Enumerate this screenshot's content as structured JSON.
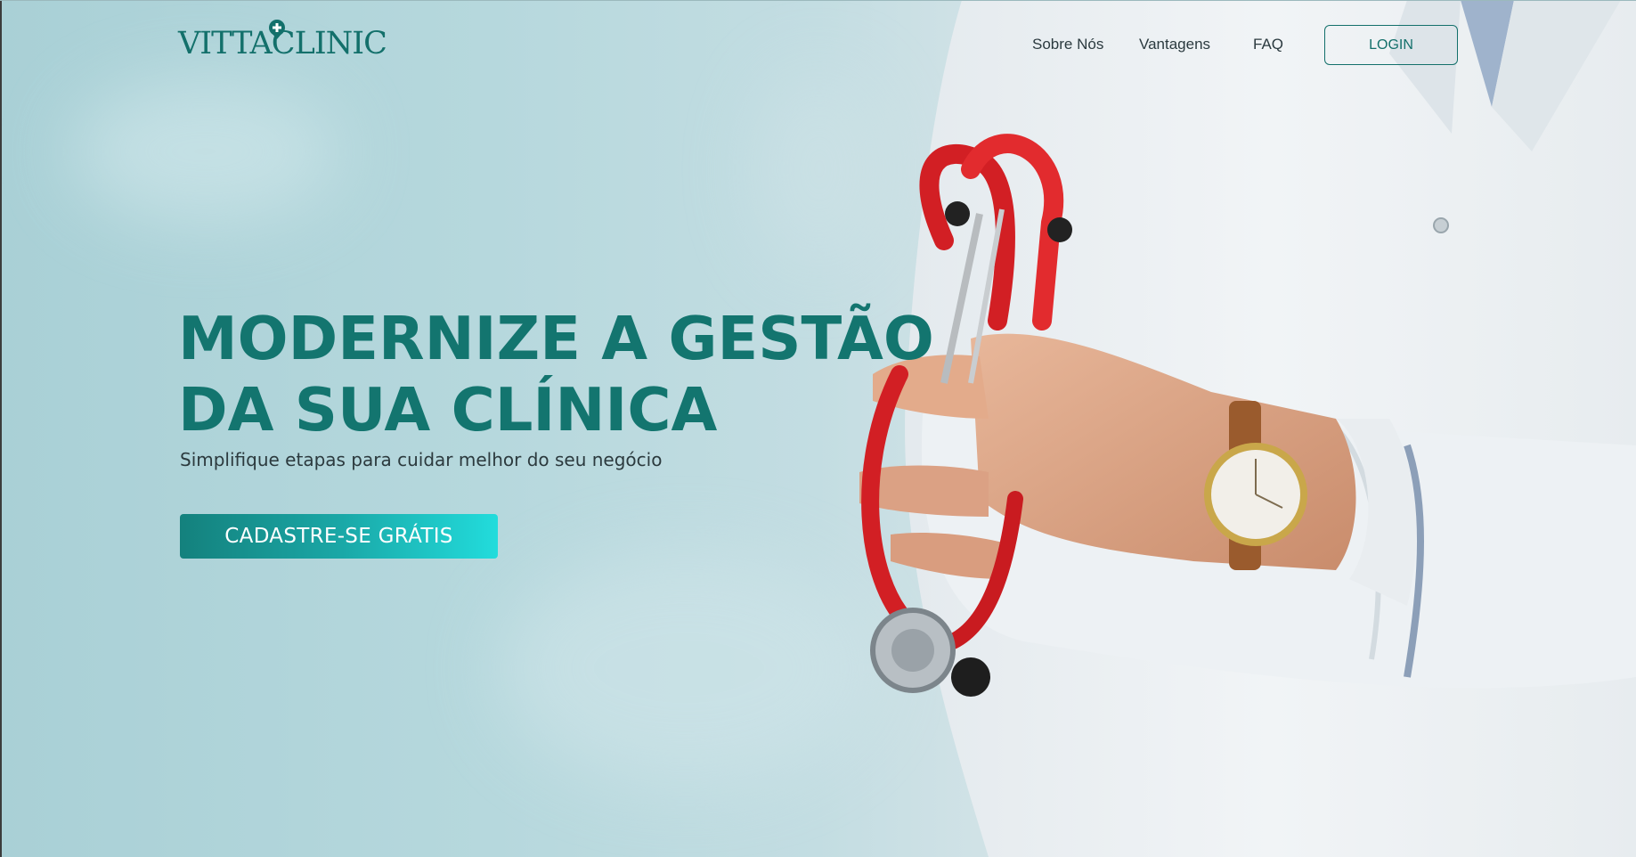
{
  "brand": {
    "logo_text": "VITTACLINIC",
    "accent_color": "#13756f",
    "cta_gradient_start": "#14817d",
    "cta_gradient_end": "#22dcdc"
  },
  "nav": {
    "items": [
      {
        "label": "Sobre Nós"
      },
      {
        "label": "Vantagens"
      },
      {
        "label": "FAQ"
      }
    ],
    "login_label": "LOGIN"
  },
  "hero": {
    "title_line1": "MODERNIZE A GESTÃO",
    "title_line2": "DA SUA CLÍNICA",
    "subtitle": "Simplifique etapas para cuidar melhor do seu negócio",
    "cta_label": "CADASTRE-SE GRÁTIS"
  },
  "icons": {
    "logo_mark": "medical-cross-pin-icon",
    "hero_image": "doctor-with-stethoscope-image"
  }
}
